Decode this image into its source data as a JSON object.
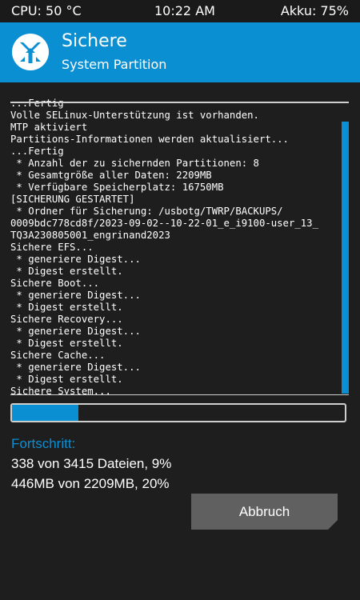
{
  "status_bar": {
    "cpu": "CPU: 50 °C",
    "time": "10:22 AM",
    "battery": "Akku: 75%"
  },
  "header": {
    "title": "Sichere",
    "subtitle": "System Partition",
    "logo_icon": "twrp-logo-icon"
  },
  "console": {
    "lines": [
      "...Fertig",
      "Volle SELinux-Unterstützung ist vorhanden.",
      "MTP aktiviert",
      "Partitions-Informationen werden aktualisiert...",
      "...Fertig",
      " * Anzahl der zu sichernden Partitionen: 8",
      " * Gesamtgröße aller Daten: 2209MB",
      " * Verfügbare Speicherplatz: 16750MB",
      "[SICHERUNG GESTARTET]",
      " * Ordner für Sicherung: /usbotg/TWRP/BACKUPS/",
      "0009bdc778cd8f/2023-09-02--10-22-01_e_i9100-user_13_",
      "TQ3A230805001_engrinand2023",
      "Sichere EFS...",
      " * generiere Digest...",
      " * Digest erstellt.",
      "Sichere Boot...",
      " * generiere Digest...",
      " * Digest erstellt.",
      "Sichere Recovery...",
      " * generiere Digest...",
      " * Digest erstellt.",
      "Sichere Cache...",
      " * generiere Digest...",
      " * Digest erstellt.",
      "Sichere System..."
    ]
  },
  "progress": {
    "label": "Fortschritt:",
    "files_text": "338 von 3415 Dateien, 9%",
    "mb_text": "446MB von 2209MB, 20%",
    "overall_fraction": 0.2,
    "partition_fraction": 0.09
  },
  "cancel_button": {
    "label": "Abbruch"
  },
  "colors": {
    "accent": "#0a8fd3",
    "background": "#1e1e1e",
    "button": "#606060"
  }
}
